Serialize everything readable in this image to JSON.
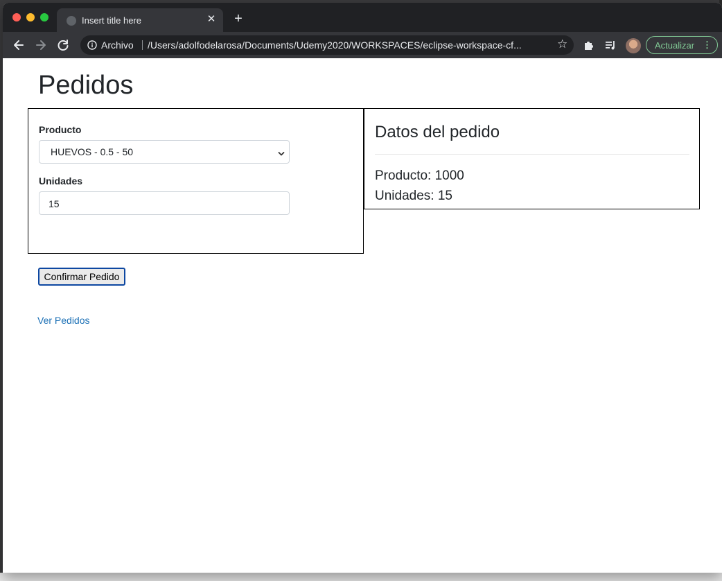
{
  "browser": {
    "tab_title": "Insert title here",
    "tab_close": "✕",
    "new_tab": "+",
    "security_label": "Archivo",
    "url": "/Users/adolfodelarosa/Documents/Udemy2020/WORKSPACES/eclipse-workspace-cf...",
    "update_label": "Actualizar",
    "menu_dots": "⋮",
    "star": "☆"
  },
  "page": {
    "title": "Pedidos",
    "form": {
      "product_label": "Producto",
      "product_selected": "HUEVOS - 0.5 - 50",
      "units_label": "Unidades",
      "units_value": "15"
    },
    "summary": {
      "title": "Datos del pedido",
      "product_line": "Producto: 1000",
      "units_line": "Unidades: 15"
    },
    "confirm_button": "Confirmar Pedido",
    "orders_link": "Ver Pedidos"
  }
}
